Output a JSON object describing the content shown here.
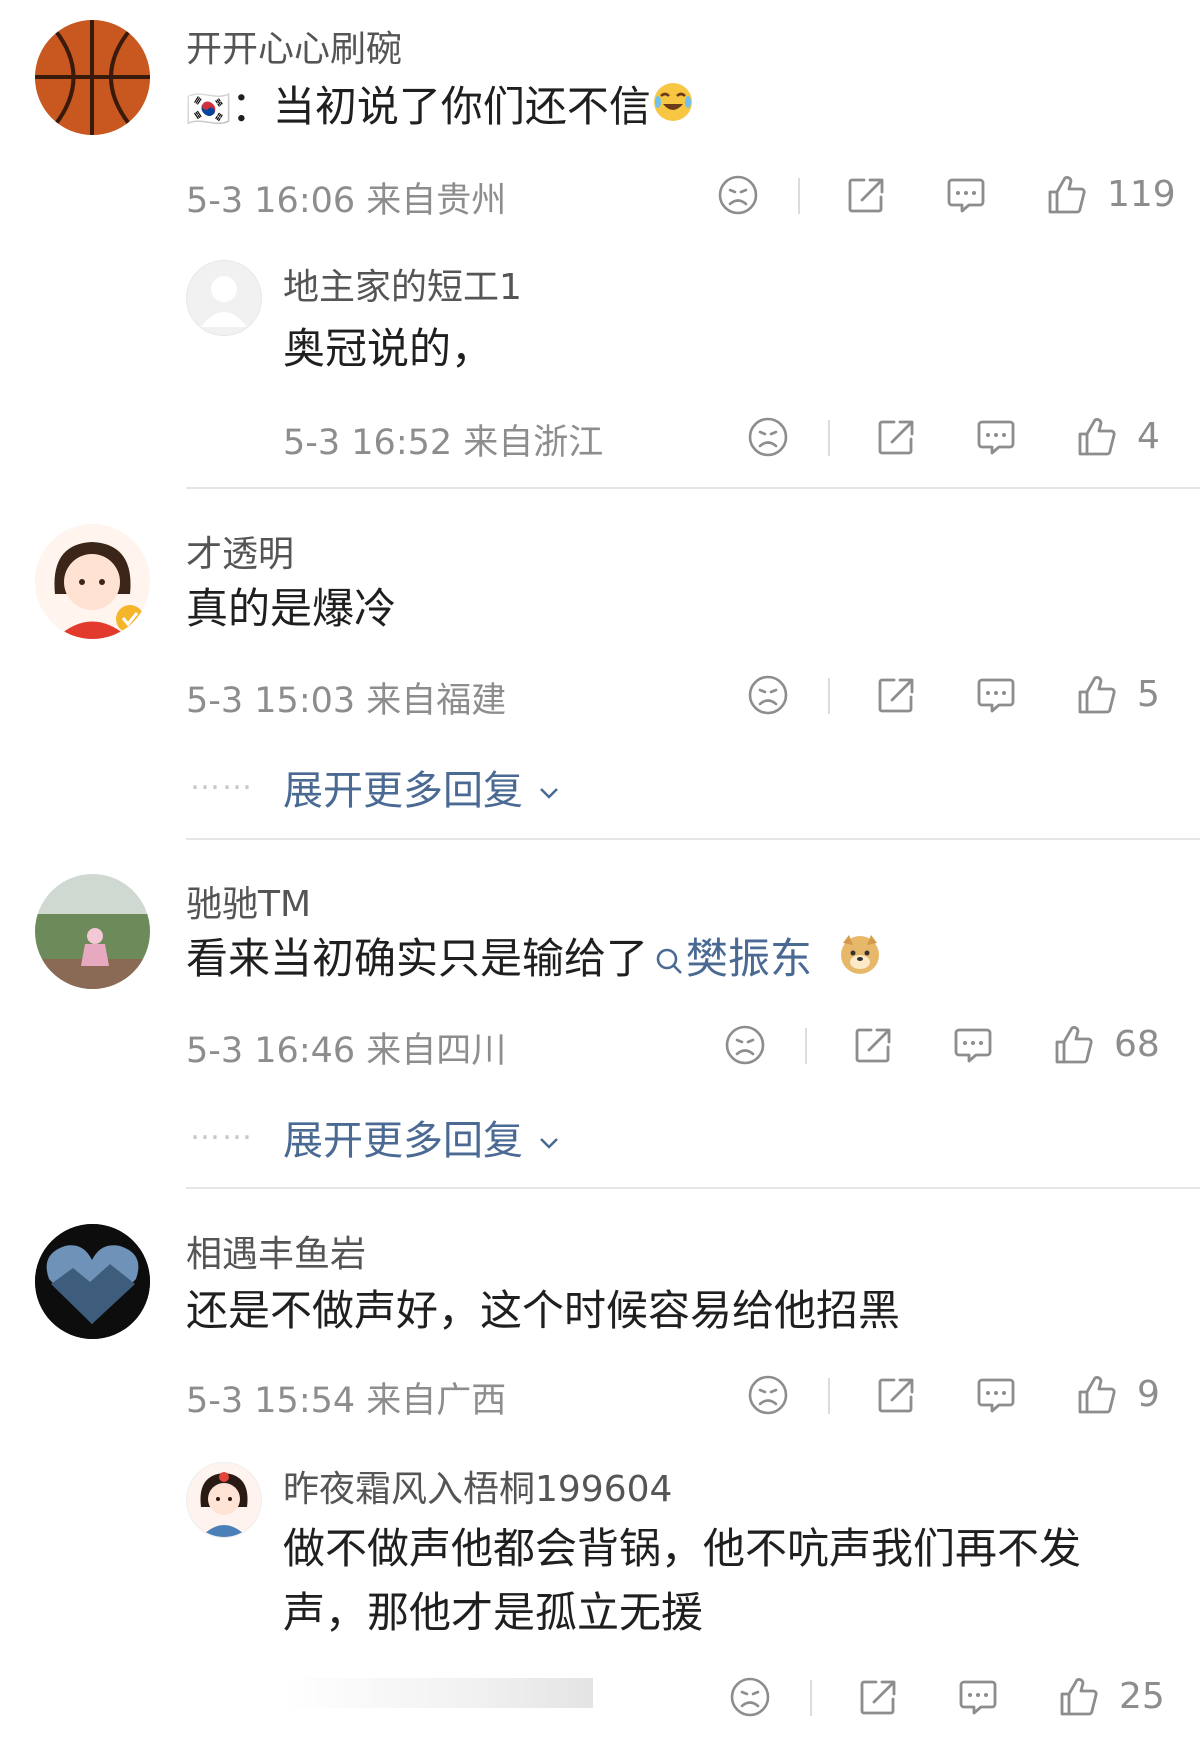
{
  "comments": [
    {
      "user": "开开心心刷碗",
      "text_prefix": "🇰🇷",
      "text": "：当初说了你们还不信",
      "meta": "5-3 16:06  来自贵州",
      "likes": "119",
      "reply": {
        "user": "地主家的短工1",
        "text": "奥冠说的，",
        "meta": "5-3 16:52  来自浙江",
        "likes": "4"
      }
    },
    {
      "user": "才透明",
      "text": "真的是爆冷",
      "meta": "5-3 15:03  来自福建",
      "likes": "5",
      "expand_label": "展开更多回复",
      "expand_dots": "……"
    },
    {
      "user": "驰驰TM",
      "text": "看来当初确实只是输给了",
      "topic": "樊振东",
      "meta": "5-3 16:46  来自四川",
      "likes": "68",
      "expand_label": "展开更多回复",
      "expand_dots": "……"
    },
    {
      "user": "相遇丰鱼岩",
      "text": "还是不做声好，这个时候容易给他招黑",
      "meta": "5-3 15:54  来自广西",
      "likes": "9",
      "reply": {
        "user": "昨夜霜风入梧桐199604",
        "text_line1": "做不做声他都会背锅，他不吭声我们再不发",
        "text_line2": "声，那他才是孤立无援",
        "likes": "25"
      }
    }
  ],
  "icons": {
    "dislike": "sad-face-icon",
    "share": "share-icon",
    "comment": "comment-bubble-icon",
    "like": "thumbs-up-icon"
  },
  "colors": {
    "link": "#4a6a93",
    "meta": "#8d8d8d",
    "verified_badge": "#f4b52a"
  }
}
